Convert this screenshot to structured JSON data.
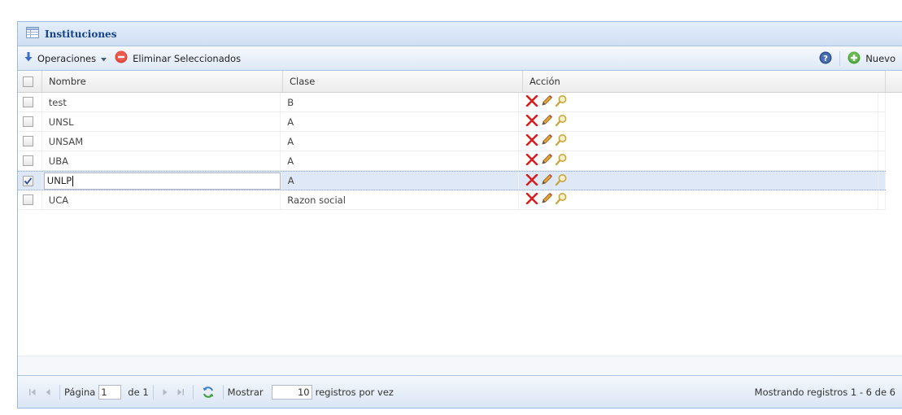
{
  "panel": {
    "title": "Instituciones"
  },
  "toolbar": {
    "operaciones_label": "Operaciones",
    "eliminar_label": "Eliminar Seleccionados",
    "nuevo_label": "Nuevo"
  },
  "grid": {
    "columns": [
      "Nombre",
      "Clase",
      "Acción"
    ],
    "rows": [
      {
        "nombre": "test",
        "clase": "B",
        "checked": false
      },
      {
        "nombre": "UNSL",
        "clase": "A",
        "checked": false
      },
      {
        "nombre": "UNSAM",
        "clase": "A",
        "checked": false
      },
      {
        "nombre": "UBA",
        "clase": "A",
        "checked": false
      },
      {
        "nombre": "UNLP",
        "clase": "A",
        "checked": true
      },
      {
        "nombre": "UCA",
        "clase": "Razon social",
        "checked": false
      }
    ]
  },
  "pager": {
    "pagina_label": "Página",
    "page_value": "1",
    "de_label": "de 1",
    "mostrar_label": "Mostrar",
    "per_page_value": "10",
    "registros_label": "registros por vez",
    "info": "Mostrando registros 1 - 6 de 6"
  },
  "colors": {
    "accent": "#15428b",
    "border": "#99bbe8",
    "selected_row": "#dfe8f6",
    "delete": "#d81e1e"
  },
  "icons": [
    "grid-icon",
    "arrow-down-icon",
    "dropdown-arrow-icon",
    "remove-icon",
    "help-icon",
    "add-icon",
    "delete-icon",
    "edit-icon",
    "view-icon",
    "first-page-icon",
    "prev-page-icon",
    "next-page-icon",
    "last-page-icon",
    "refresh-icon"
  ]
}
